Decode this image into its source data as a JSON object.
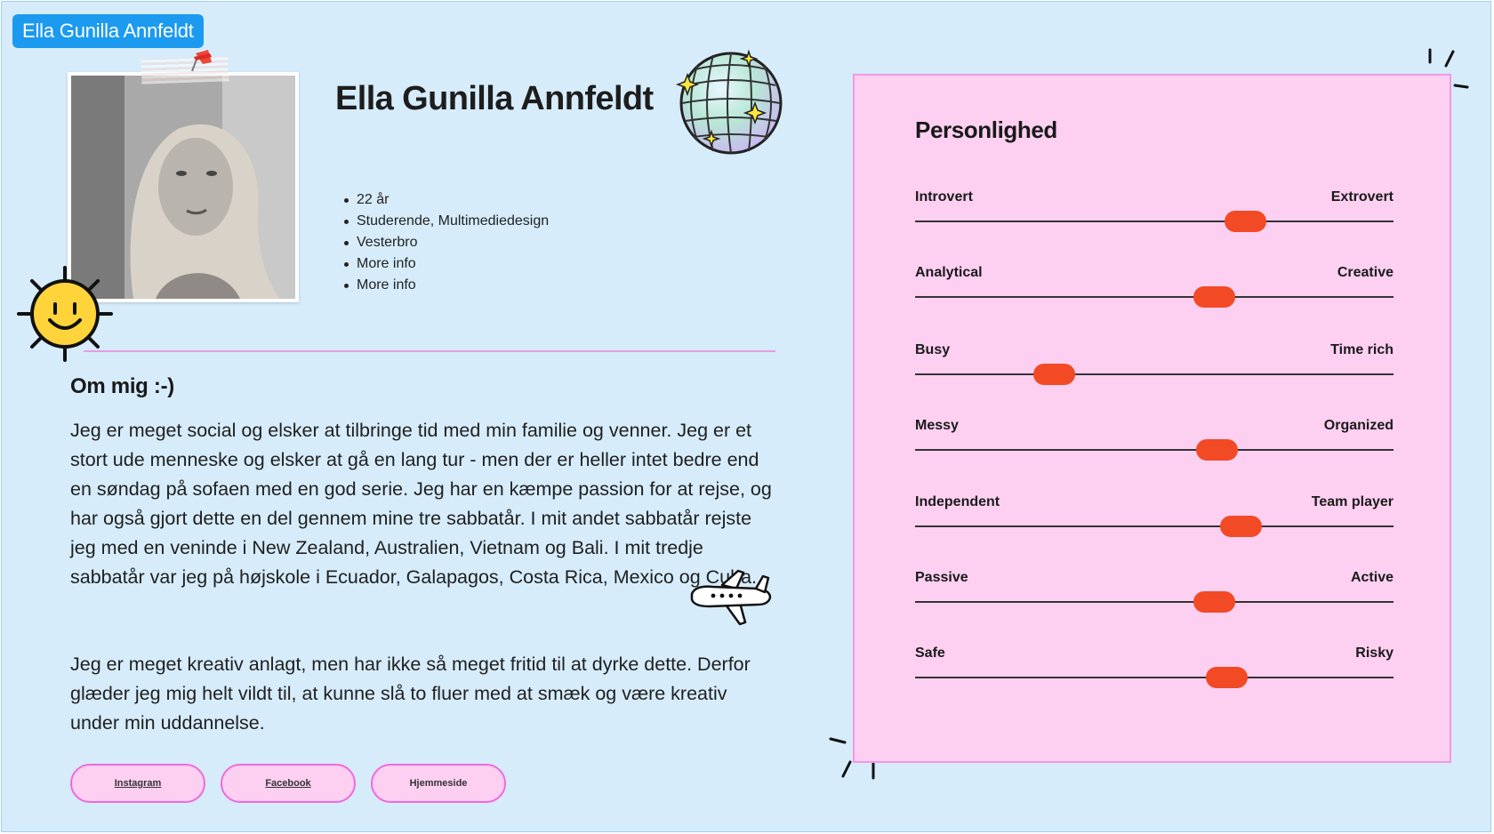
{
  "window": {
    "tag": "Ella Gunilla Annfeldt"
  },
  "profile": {
    "name": "Ella Gunilla Annfeldt",
    "facts": [
      "22 år",
      "Studerende, Multimediedesign",
      "Vesterbro",
      "More info",
      "More info"
    ]
  },
  "about": {
    "title": "Om mig :-)",
    "paragraph1": "Jeg er meget social og elsker at tilbringe tid med min familie og venner. Jeg er et stort ude menneske og elsker at gå en lang tur - men der er heller intet bedre end en søndag på sofaen med en god serie. Jeg har en kæmpe passion for at rejse, og har også gjort dette en del gennem mine tre sabbatår. I mit andet sabbatår rejste jeg med en veninde i New Zealand, Australien, Vietnam og Bali. I mit tredje sabbatår var jeg på højskole i Ecuador, Galapagos, Costa Rica, Mexico og Cuba.",
    "paragraph2": "Jeg er meget kreativ anlagt, men har ikke så meget fritid til at dyrke dette. Derfor glæder jeg mig helt vildt til, at kunne slå to fluer med at smæk og være kreativ under min uddannelse."
  },
  "links": [
    "Instagram",
    "Facebook",
    "Hjemmeside"
  ],
  "personality": {
    "title": "Personlighed",
    "traits": [
      {
        "left": "Introvert",
        "right": "Extrovert",
        "value": 0.69
      },
      {
        "left": "Analytical",
        "right": "Creative",
        "value": 0.625
      },
      {
        "left": "Busy",
        "right": "Time rich",
        "value": 0.29
      },
      {
        "left": "Messy",
        "right": "Organized",
        "value": 0.63
      },
      {
        "left": "Independent",
        "right": "Team player",
        "value": 0.68
      },
      {
        "left": "Passive",
        "right": "Active",
        "value": 0.625
      },
      {
        "left": "Safe",
        "right": "Risky",
        "value": 0.65
      }
    ]
  },
  "colors": {
    "background": "#d6ecfb",
    "tag": "#1b9af0",
    "panel": "#fdd0f2",
    "thumb": "#f24a24",
    "accent": "#f06ad9"
  },
  "icons": [
    "pushpin-icon",
    "sun-smiley-icon",
    "disco-ball-icon",
    "airplane-icon",
    "sparkle-icon"
  ]
}
